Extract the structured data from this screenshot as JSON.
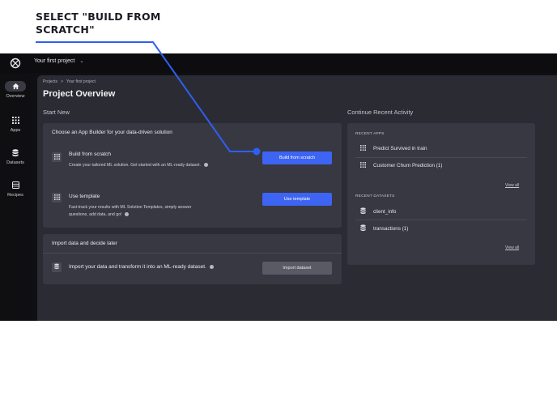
{
  "annotation": {
    "callout_line1": "SELECT \"BUILD FROM",
    "callout_line2": "SCRATCH\"",
    "pointer_color": "#2f5ff0"
  },
  "topbar": {
    "project_name": "Your first project",
    "chevron_icon": "chevron-down-icon"
  },
  "sidebar": {
    "items": [
      {
        "label": "Overview",
        "icon": "home-icon"
      },
      {
        "label": "Apps",
        "icon": "grid-icon"
      },
      {
        "label": "Datasets",
        "icon": "database-icon"
      },
      {
        "label": "Recipes",
        "icon": "recipe-icon"
      }
    ]
  },
  "breadcrumb": {
    "root": "Projects",
    "separator": ">",
    "current": "Your first project"
  },
  "page": {
    "title": "Project Overview",
    "start_new": "Start New",
    "continue_recent": "Continue Recent Activity"
  },
  "app_builder": {
    "title": "Choose an App Builder for your data-driven solution",
    "build_from_scratch": {
      "title": "Build from scratch",
      "description": "Create your tailored ML solution. Get started with an ML-ready dataset.",
      "button": "Build from scratch"
    },
    "use_template": {
      "title": "Use template",
      "description_line1": "Fast-track your results with ML Solution Templates, simply answer",
      "description_line2": "questions, add data, and go!",
      "button": "Use template"
    }
  },
  "import": {
    "title": "Import data and decide later",
    "description": "Import your data and transform it into an ML-ready dataset.",
    "button": "Import dataset"
  },
  "recent": {
    "apps_label": "RECENT APPS",
    "apps": [
      "Predict Survived in train",
      "Customer Churn Prediction (1)"
    ],
    "datasets_label": "RECENT DATASETS",
    "datasets": [
      "client_info",
      "transactions (1)"
    ],
    "view_all": "View all"
  },
  "colors": {
    "primary_button": "#3d64f2",
    "background": "#101014",
    "panel": "#2b2b33",
    "card": "#383842"
  }
}
